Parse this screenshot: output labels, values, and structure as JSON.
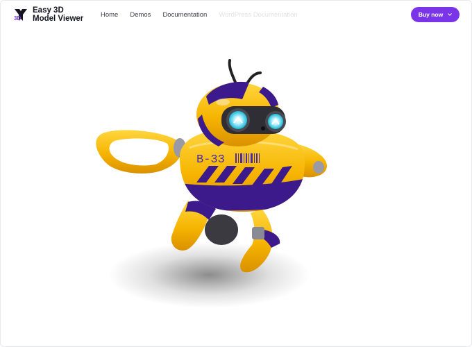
{
  "header": {
    "brand": {
      "logo_text": "3D",
      "title_line1": "Easy 3D",
      "title_line2": "Model Viewer"
    },
    "nav": [
      {
        "label": "Home",
        "active": true
      },
      {
        "label": "Demos"
      },
      {
        "label": "Documentation"
      },
      {
        "label": "WordPress Documentation"
      }
    ],
    "cta": {
      "label": "Buy now",
      "icon": "chevron-down-icon"
    }
  },
  "viewer": {
    "model_decal_text": "B-33"
  },
  "colors": {
    "accent": "#7a35e8",
    "robot_yellow": "#f6b400",
    "robot_purple": "#3c1a8c"
  }
}
